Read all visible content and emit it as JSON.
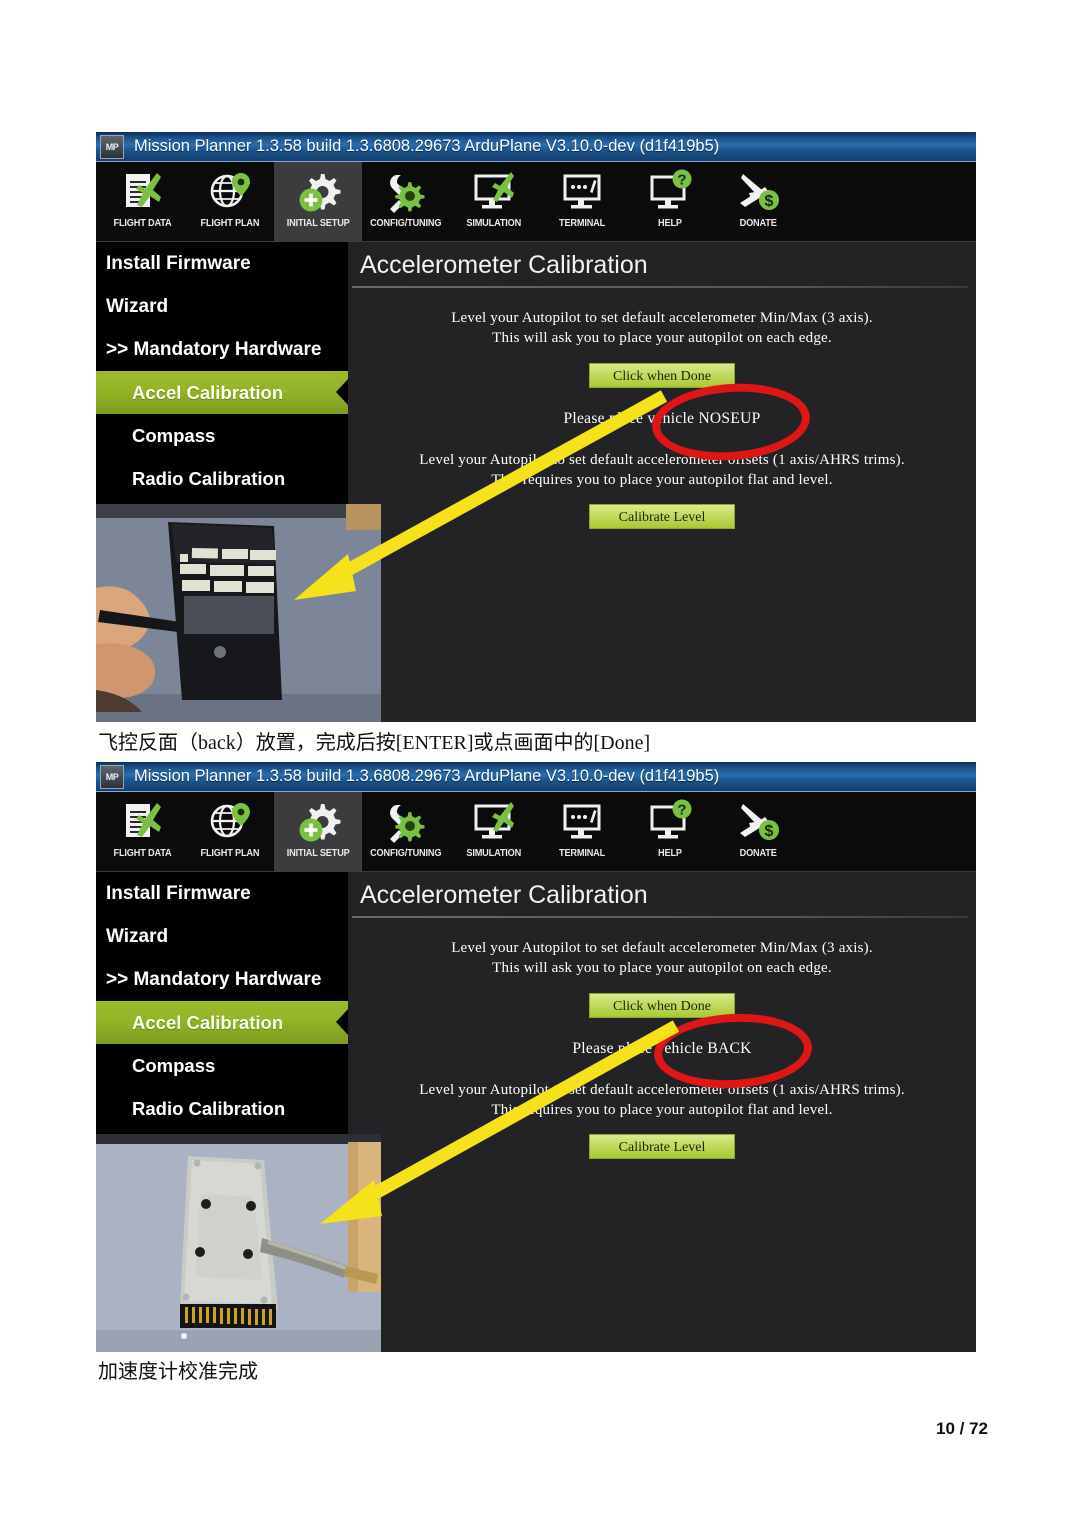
{
  "document": {
    "page_number": "10 / 72",
    "caption_1": "飞控反面（back）放置，完成后按[ENTER]或点画面中的[Done]",
    "caption_2": "加速度计校准完成"
  },
  "screenshot_1": {
    "titlebar": {
      "app_icon": "MP",
      "text": "Mission Planner 1.3.58 build 1.3.6808.29673 ArduPlane V3.10.0-dev (d1f419b5)"
    },
    "toolbar": [
      {
        "label": "FLIGHT DATA",
        "icon": "flight-data-icon",
        "active": false
      },
      {
        "label": "FLIGHT PLAN",
        "icon": "flight-plan-icon",
        "active": false
      },
      {
        "label": "INITIAL SETUP",
        "icon": "initial-setup-icon",
        "active": true
      },
      {
        "label": "CONFIG/TUNING",
        "icon": "config-tuning-icon",
        "active": false
      },
      {
        "label": "SIMULATION",
        "icon": "simulation-icon",
        "active": false
      },
      {
        "label": "TERMINAL",
        "icon": "terminal-icon",
        "active": false
      },
      {
        "label": "HELP",
        "icon": "help-icon",
        "active": false
      },
      {
        "label": "DONATE",
        "icon": "donate-icon",
        "active": false
      }
    ],
    "sidebar": [
      {
        "label": "Install Firmware",
        "indent": false,
        "selected": false
      },
      {
        "label": "Wizard",
        "indent": false,
        "selected": false
      },
      {
        "label": ">> Mandatory Hardware",
        "indent": false,
        "selected": false
      },
      {
        "label": "Accel Calibration",
        "indent": true,
        "selected": true
      },
      {
        "label": "Compass",
        "indent": true,
        "selected": false
      },
      {
        "label": "Radio Calibration",
        "indent": true,
        "selected": false
      }
    ],
    "content": {
      "title": "Accelerometer Calibration",
      "paragraph_1_line_1": "Level your Autopilot to set default accelerometer Min/Max (3 axis).",
      "paragraph_1_line_2": "This will ask you to place your autopilot on each edge.",
      "done_button": "Click when Done",
      "prompt": "Please place vehicle NOSEUP",
      "paragraph_2_line_1": "Level your Autopilot to set default accelerometer offsets (1 axis/AHRS trims).",
      "paragraph_2_line_2": "This requires you to place your autopilot flat and level.",
      "calibrate_button": "Calibrate Level"
    },
    "photo": {
      "name": "photo-hand-holding-autopilot-noseup",
      "description": "Hand holding a black autopilot enclosure standing on its edge (nose up) on a grey desk mat"
    },
    "annotations": {
      "red_circle_target": "Please place vehicle NOSEUP",
      "yellow_arrow": "points from the prompt text down-left into the photo"
    }
  },
  "screenshot_2": {
    "titlebar": {
      "app_icon": "MP",
      "text": "Mission Planner 1.3.58 build 1.3.6808.29673 ArduPlane V3.10.0-dev (d1f419b5)"
    },
    "toolbar": [
      {
        "label": "FLIGHT DATA",
        "icon": "flight-data-icon",
        "active": false
      },
      {
        "label": "FLIGHT PLAN",
        "icon": "flight-plan-icon",
        "active": false
      },
      {
        "label": "INITIAL SETUP",
        "icon": "initial-setup-icon",
        "active": true
      },
      {
        "label": "CONFIG/TUNING",
        "icon": "config-tuning-icon",
        "active": false
      },
      {
        "label": "SIMULATION",
        "icon": "simulation-icon",
        "active": false
      },
      {
        "label": "TERMINAL",
        "icon": "terminal-icon",
        "active": false
      },
      {
        "label": "HELP",
        "icon": "help-icon",
        "active": false
      },
      {
        "label": "DONATE",
        "icon": "donate-icon",
        "active": false
      }
    ],
    "sidebar": [
      {
        "label": "Install Firmware",
        "indent": false,
        "selected": false
      },
      {
        "label": "Wizard",
        "indent": false,
        "selected": false
      },
      {
        "label": ">> Mandatory Hardware",
        "indent": false,
        "selected": false
      },
      {
        "label": "Accel Calibration",
        "indent": true,
        "selected": true
      },
      {
        "label": "Compass",
        "indent": true,
        "selected": false
      },
      {
        "label": "Radio Calibration",
        "indent": true,
        "selected": false
      }
    ],
    "content": {
      "title": "Accelerometer Calibration",
      "paragraph_1_line_1": "Level your Autopilot to set default accelerometer Min/Max (3 axis).",
      "paragraph_1_line_2": "This will ask you to place your autopilot on each edge.",
      "done_button": "Click when Done",
      "prompt": "Please place vehicle BACK",
      "paragraph_2_line_1": "Level your Autopilot to set default accelerometer offsets (1 axis/AHRS trims).",
      "paragraph_2_line_2": "This requires you to place your autopilot flat and level.",
      "calibrate_button": "Calibrate Level"
    },
    "photo": {
      "name": "photo-autopilot-back-on-table",
      "description": "Silver metal autopilot case lying back-side up on a light blue desk mat with a cable"
    },
    "annotations": {
      "red_circle_target": "Please place vehicle BACK",
      "yellow_arrow": "points from the prompt text down-left into the photo"
    }
  },
  "colors": {
    "titlebar_blue": "#1b4f86",
    "selected_green": "#93b428",
    "button_green": "#c5dc63",
    "annotation_red": "#e01616",
    "annotation_yellow": "#f5e21a",
    "panel_dark": "#232326",
    "sidebar_black": "#000000"
  }
}
